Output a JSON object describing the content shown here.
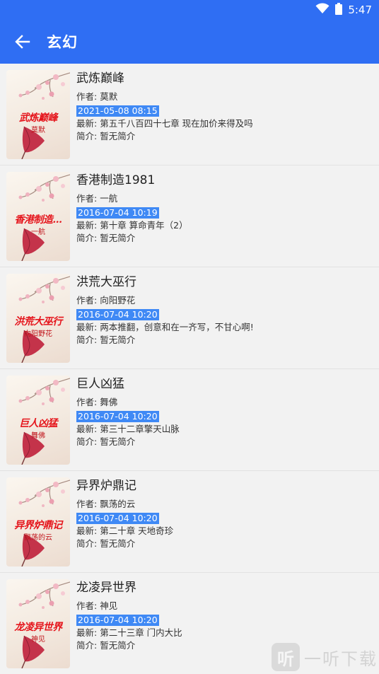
{
  "status": {
    "time": "5:47"
  },
  "toolbar": {
    "title": "玄幻"
  },
  "labels": {
    "author_prefix": "作者: ",
    "latest_prefix": "最新: ",
    "intro_prefix": "简介: "
  },
  "books": [
    {
      "name": "武炼巅峰",
      "cover_title": "武炼巅峰",
      "author": "莫默",
      "updated": "2021-05-08 08:15",
      "latest": "第五千八百四十七章 现在加价来得及吗",
      "intro": "暂无简介"
    },
    {
      "name": "香港制造1981",
      "cover_title": "香港制造...",
      "author": "一航",
      "updated": "2016-07-04 10:19",
      "latest": "第十章 算命青年（2）",
      "intro": "暂无简介"
    },
    {
      "name": "洪荒大巫行",
      "cover_title": "洪荒大巫行",
      "author": "向阳野花",
      "updated": "2016-07-04 10:20",
      "latest": "两本推翻，创意和在一齐写，不甘心啊!",
      "intro": "暂无简介"
    },
    {
      "name": "巨人凶猛",
      "cover_title": "巨人凶猛",
      "author": "舞佛",
      "updated": "2016-07-04 10:20",
      "latest": "第三十二章擎天山脉",
      "intro": "暂无简介"
    },
    {
      "name": "异界炉鼎记",
      "cover_title": "异界炉鼎记",
      "author": "飘荡的云",
      "updated": "2016-07-04 10:20",
      "latest": "第二十章 天地奇珍",
      "intro": "暂无简介"
    },
    {
      "name": "龙凌异世界",
      "cover_title": "龙凌异世界",
      "author": "神见",
      "updated": "2016-07-04 10:20",
      "latest": "第二十三章 门内大比",
      "intro": "暂无简介"
    }
  ],
  "watermark": {
    "icon": "听",
    "text": "一听下载"
  },
  "colors": {
    "appbar": "#2f6ef3",
    "date_bg": "#3f89f5",
    "cover_title": "#e5141b"
  }
}
